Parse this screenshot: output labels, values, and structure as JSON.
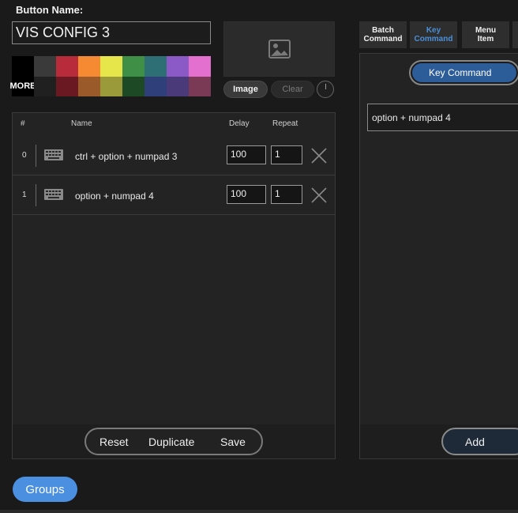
{
  "header": {
    "button_name_label": "Button Name:"
  },
  "name_field": {
    "value": "VIS CONFIG 3"
  },
  "palette": {
    "more_label": "MORE",
    "top_row": [
      "#3a3a3a",
      "#b82b3b",
      "#f58a33",
      "#e6e64a",
      "#3f8f47",
      "#2e6f75",
      "#8b5ac7",
      "#e36fcf"
    ],
    "bottom_row": [
      "#6a1822",
      "#9a5a2a",
      "#9a9a3a",
      "#1d4a24",
      "#2e3f7a",
      "#4a3a7a",
      "#7a3a55"
    ]
  },
  "image_area": {
    "image_label": "Image",
    "clear_label": "Clear"
  },
  "table": {
    "headers": {
      "index": "#",
      "name": "Name",
      "delay": "Delay",
      "repeat": "Repeat"
    },
    "rows": [
      {
        "index": "0",
        "name": "ctrl + option + numpad 3",
        "delay": "100",
        "repeat": "1"
      },
      {
        "index": "1",
        "name": "option + numpad 4",
        "delay": "100",
        "repeat": "1"
      }
    ]
  },
  "actions": {
    "reset": "Reset",
    "duplicate": "Duplicate",
    "save": "Save"
  },
  "tabs": [
    {
      "label": "Batch Command",
      "active": false
    },
    {
      "label": "Key Command",
      "active": true
    },
    {
      "label": "Menu Item",
      "active": false
    }
  ],
  "right": {
    "mode_label": "Key Command",
    "command_value": "option + numpad 4",
    "add_label": "Add"
  },
  "groups_label": "Groups",
  "colors": {
    "accent": "#4a8fe0",
    "active_tab": "#4a8fd9",
    "toggle": "#2c5d99"
  }
}
